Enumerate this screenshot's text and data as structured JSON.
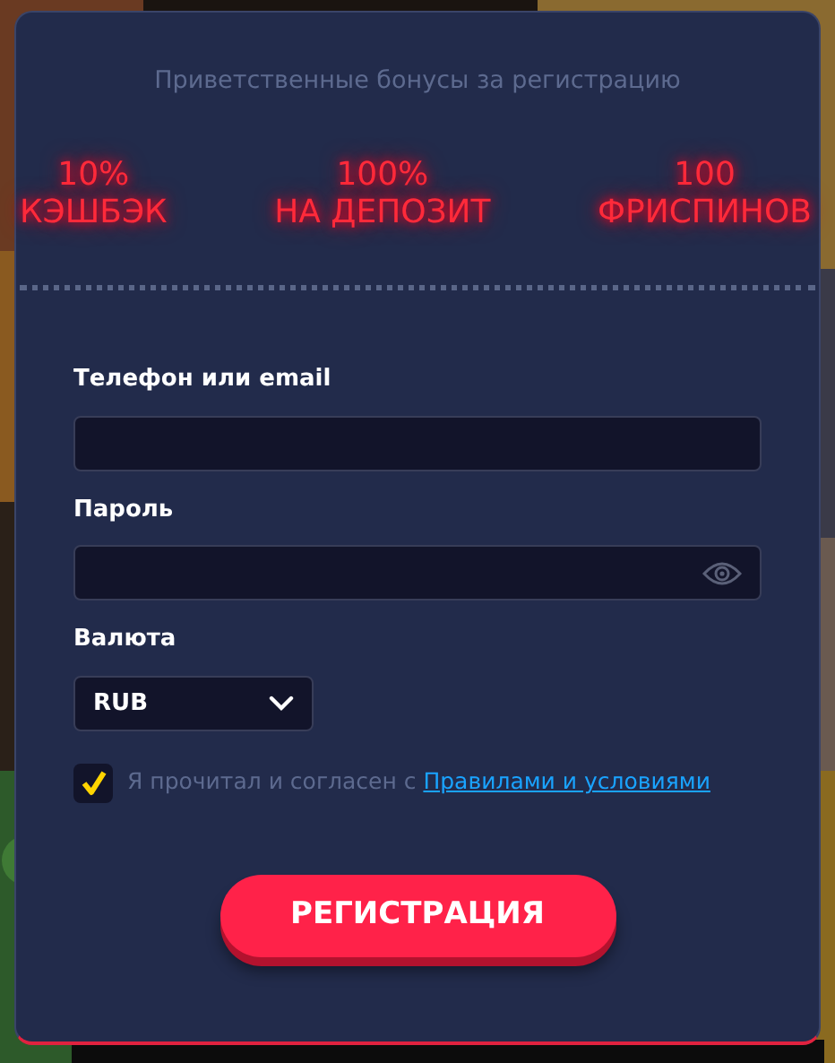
{
  "bonus_title": "Приветственные бонусы за регистрацию",
  "bonuses": [
    {
      "line_1": "10%",
      "line_2": "КЭШБЭК"
    },
    {
      "line_1": "100%",
      "line_2": "НА ДЕПОЗИТ"
    },
    {
      "line_1": "100",
      "line_2": "ФРИСПИНОВ"
    }
  ],
  "fields": [
    {
      "kind": "text",
      "label": "Телефон или email"
    },
    {
      "kind": "password",
      "label": "Пароль"
    },
    {
      "kind": "select",
      "label": "Валюта",
      "value": "RUB"
    }
  ],
  "agreement": {
    "checked": true,
    "text": "Я прочитал и согласен с",
    "link": "Правилами и условиями"
  },
  "submit": "РЕГИСТРАЦИЯ"
}
